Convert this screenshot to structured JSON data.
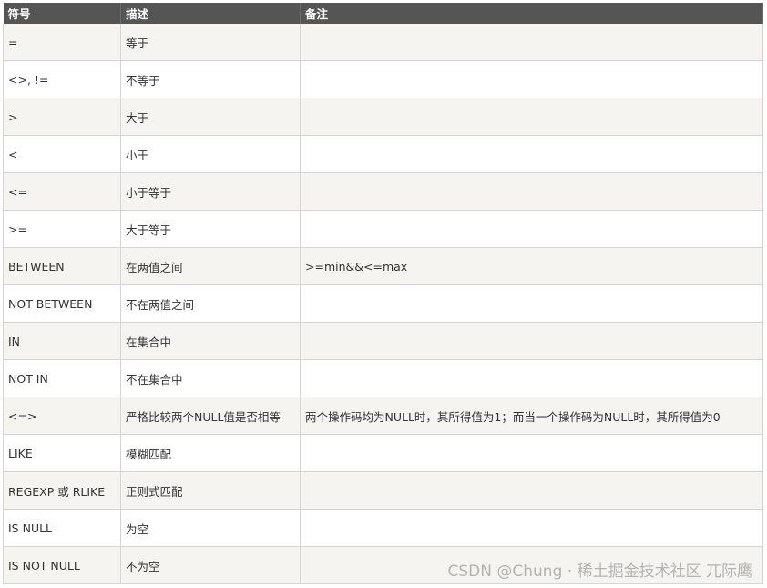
{
  "table": {
    "headers": [
      "符号",
      "描述",
      "备注"
    ],
    "rows": [
      [
        "=",
        "等于",
        ""
      ],
      [
        "<>, !=",
        "不等于",
        ""
      ],
      [
        ">",
        "大于",
        ""
      ],
      [
        "<",
        "小于",
        ""
      ],
      [
        "<=",
        "小于等于",
        ""
      ],
      [
        ">=",
        "大于等于",
        ""
      ],
      [
        "BETWEEN",
        "在两值之间",
        ">=min&&<=max"
      ],
      [
        "NOT BETWEEN",
        "不在两值之间",
        ""
      ],
      [
        "IN",
        "在集合中",
        ""
      ],
      [
        "NOT IN",
        "不在集合中",
        ""
      ],
      [
        "<=>",
        "严格比较两个NULL值是否相等",
        "两个操作码均为NULL时，其所得值为1；而当一个操作码为NULL时，其所得值为0"
      ],
      [
        "LIKE",
        "模糊匹配",
        ""
      ],
      [
        "REGEXP 或 RLIKE",
        "正则式匹配",
        ""
      ],
      [
        "IS NULL",
        "为空",
        ""
      ],
      [
        "IS NOT NULL",
        "不为空",
        ""
      ]
    ]
  },
  "watermark": "CSDN @Chung · 稀土掘金技术社区 兀际鹰"
}
